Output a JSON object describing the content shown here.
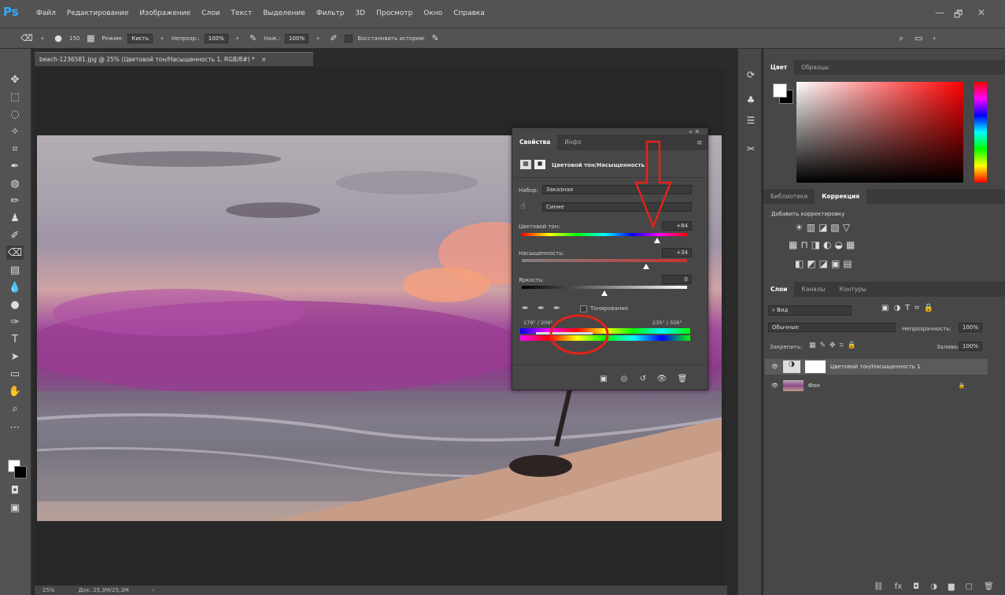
{
  "app": {
    "logo": "Ps"
  },
  "menu": [
    "Файл",
    "Редактирование",
    "Изображение",
    "Слои",
    "Текст",
    "Выделение",
    "Фильтр",
    "3D",
    "Просмотр",
    "Окно",
    "Справка"
  ],
  "window_controls": {
    "minimize": "—",
    "restore": "🗗",
    "close": "✕"
  },
  "options_bar": {
    "brush_size": "150",
    "mode_label": "Режим:",
    "mode_value": "Кисть",
    "opacity_label": "Непрозр.:",
    "opacity_value": "100%",
    "flow_label": "Наж.:",
    "flow_value": "100%",
    "restore_history": "Восстановить историю"
  },
  "document": {
    "tab_title": "beach-1236581.jpg @ 25% (Цветовой тон/Насыщенность 1, RGB/8#) *",
    "close": "×",
    "zoom": "25%",
    "doc_size": "Док: 25,3M/25,3M"
  },
  "properties": {
    "tabs": [
      "Свойства",
      "Инфо"
    ],
    "title": "Цветовой тон/Насыщенность",
    "preset_label": "Набор:",
    "preset_value": "Заказная",
    "channel_value": "Синие",
    "hue_label": "Цветовой тон:",
    "hue_value": "+84",
    "saturation_label": "Насыщенность:",
    "saturation_value": "+34",
    "lightness_label": "Яркость:",
    "lightness_value": "0",
    "colorize_label": "Тонирование",
    "range_left": "179° / 209°",
    "range_right": "235° | 326°",
    "hue_position": 0.82,
    "saturation_position": 0.75,
    "lightness_position": 0.5
  },
  "right": {
    "color_tabs": [
      "Цвет",
      "Образцы"
    ],
    "adj_tabs": [
      "Библиотеки",
      "Коррекция"
    ],
    "adj_title": "Добавить корректировку",
    "layer_tabs": [
      "Слои",
      "Каналы",
      "Контуры"
    ],
    "kind_filter": "Вид",
    "blend_mode": "Обычные",
    "opacity_label": "Непрозрачность:",
    "opacity_value": "100%",
    "lock_label": "Закрепить:",
    "fill_label": "Заливка:",
    "fill_value": "100%",
    "layers": [
      {
        "name": "Цветовой тон/Насыщенность 1"
      },
      {
        "name": "Фон"
      }
    ]
  },
  "colors": {
    "panel": "#474747",
    "chrome": "#535353",
    "accent": "#31a8ff",
    "annotation": "#e2231a"
  }
}
